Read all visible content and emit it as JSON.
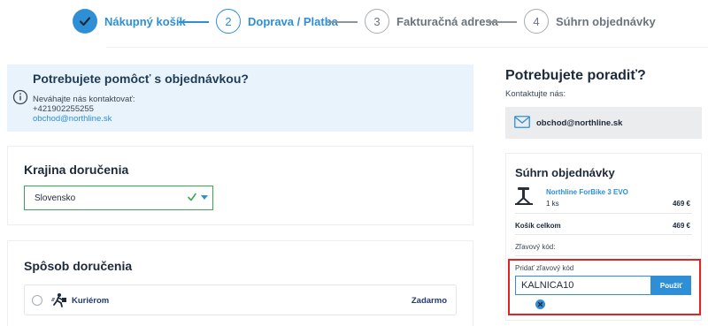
{
  "stepper": {
    "steps": [
      {
        "number": "",
        "label": "Nákupný košík",
        "state": "done"
      },
      {
        "number": "2",
        "label": "Doprava / Platba",
        "state": "active"
      },
      {
        "number": "3",
        "label": "Fakturačná adresa",
        "state": "todo"
      },
      {
        "number": "4",
        "label": "Súhrn objednávky",
        "state": "todo"
      }
    ]
  },
  "help": {
    "title": "Potrebujete pomôcť s objednávkou?",
    "line1": "Neváhajte nás kontaktovať:",
    "phone": "+421902255255",
    "email": "obchod@northline.sk"
  },
  "country": {
    "title": "Krajina doručenia",
    "selected": "Slovensko"
  },
  "shipping": {
    "title": "Spôsob doručenia",
    "options": [
      {
        "name": "Kuriérom",
        "price": "Zadarmo"
      }
    ]
  },
  "advise": {
    "title": "Potrebujete poradiť?",
    "subtitle": "Kontaktujte nás:",
    "email": "obchod@northline.sk"
  },
  "summary": {
    "title": "Súhrn objednávky",
    "product": {
      "name": "Northline ForBike 3 EVO",
      "qty": "1 ks",
      "price": "469 €"
    },
    "total_label": "Košík celkom",
    "total_value": "469 €",
    "discount_label": "Zľavový kód:",
    "add_discount_label": "Pridať zľavový kód",
    "discount_code": "KALNICA10",
    "apply_label": "Použiť"
  },
  "colors": {
    "accent": "#2e8fd6",
    "valid": "#3aa655",
    "highlight": "#e02424",
    "banner_bg": "#e9f3fb"
  }
}
